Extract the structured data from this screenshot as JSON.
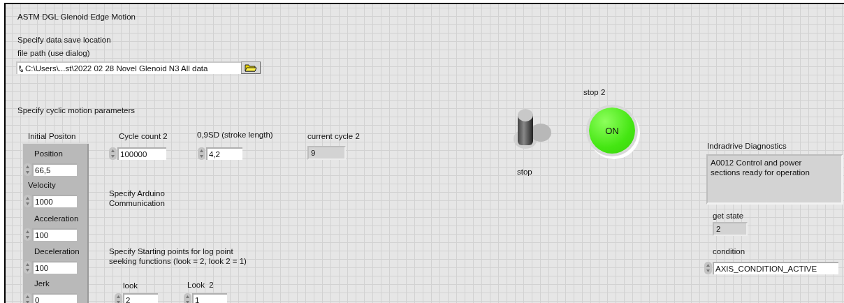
{
  "panel_title": "ASTM DGL Glenoid Edge Motion",
  "save_section": {
    "heading": "Specify data save location",
    "path_label": "file path (use dialog)",
    "path_value": "C:\\Users\\...st\\2022 02 28 Novel Glenoid N3 All data"
  },
  "motion_heading": "Specify cyclic motion parameters",
  "initial_position": {
    "label": "Initial Positon",
    "fields": [
      {
        "label": "Position",
        "value": "66,5"
      },
      {
        "label": "Velocity",
        "value": "1000"
      },
      {
        "label": "Acceleration",
        "value": "100"
      },
      {
        "label": "Deceleration",
        "value": "100"
      },
      {
        "label": "Jerk",
        "value": "0"
      }
    ]
  },
  "cycle_count": {
    "label": "Cycle count 2",
    "value": "100000"
  },
  "stroke_length": {
    "label": "0,9SD (stroke length)",
    "value": "4,2"
  },
  "current_cycle": {
    "label": "current cycle 2",
    "value": "9"
  },
  "arduino_note": "Specify Arduino Communication",
  "log_note": "Specify Starting points for log point seeking functions (look = 2, look 2 = 1)",
  "look": {
    "label": "look",
    "value": "2"
  },
  "look2": {
    "label": "Look  2",
    "value": "1"
  },
  "stop_switch": {
    "label": "stop",
    "on": false
  },
  "stop2_button": {
    "label": "stop 2",
    "text": "ON",
    "on": true
  },
  "diagnostics": {
    "label": "Indradrive Diagnostics",
    "value": "A0012 Control and power sections ready for operation"
  },
  "get_state": {
    "label": "get state",
    "value": "2"
  },
  "condition": {
    "label": "condition",
    "value": "AXIS_CONDITION_ACTIVE"
  }
}
